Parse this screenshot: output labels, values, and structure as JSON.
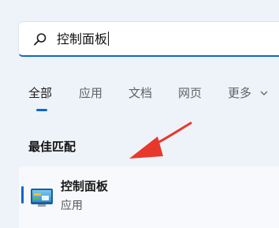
{
  "search": {
    "query": "控制面板"
  },
  "tabs": [
    {
      "label": "全部"
    },
    {
      "label": "应用"
    },
    {
      "label": "文档"
    },
    {
      "label": "网页"
    },
    {
      "label": "更多"
    }
  ],
  "best_match": {
    "heading": "最佳匹配",
    "result": {
      "name": "控制面板",
      "type": "应用",
      "icon": "control-panel-icon"
    }
  },
  "colors": {
    "accent": "#0f67c9",
    "annotation_arrow": "#e8382c",
    "background": "#eef3f9"
  }
}
